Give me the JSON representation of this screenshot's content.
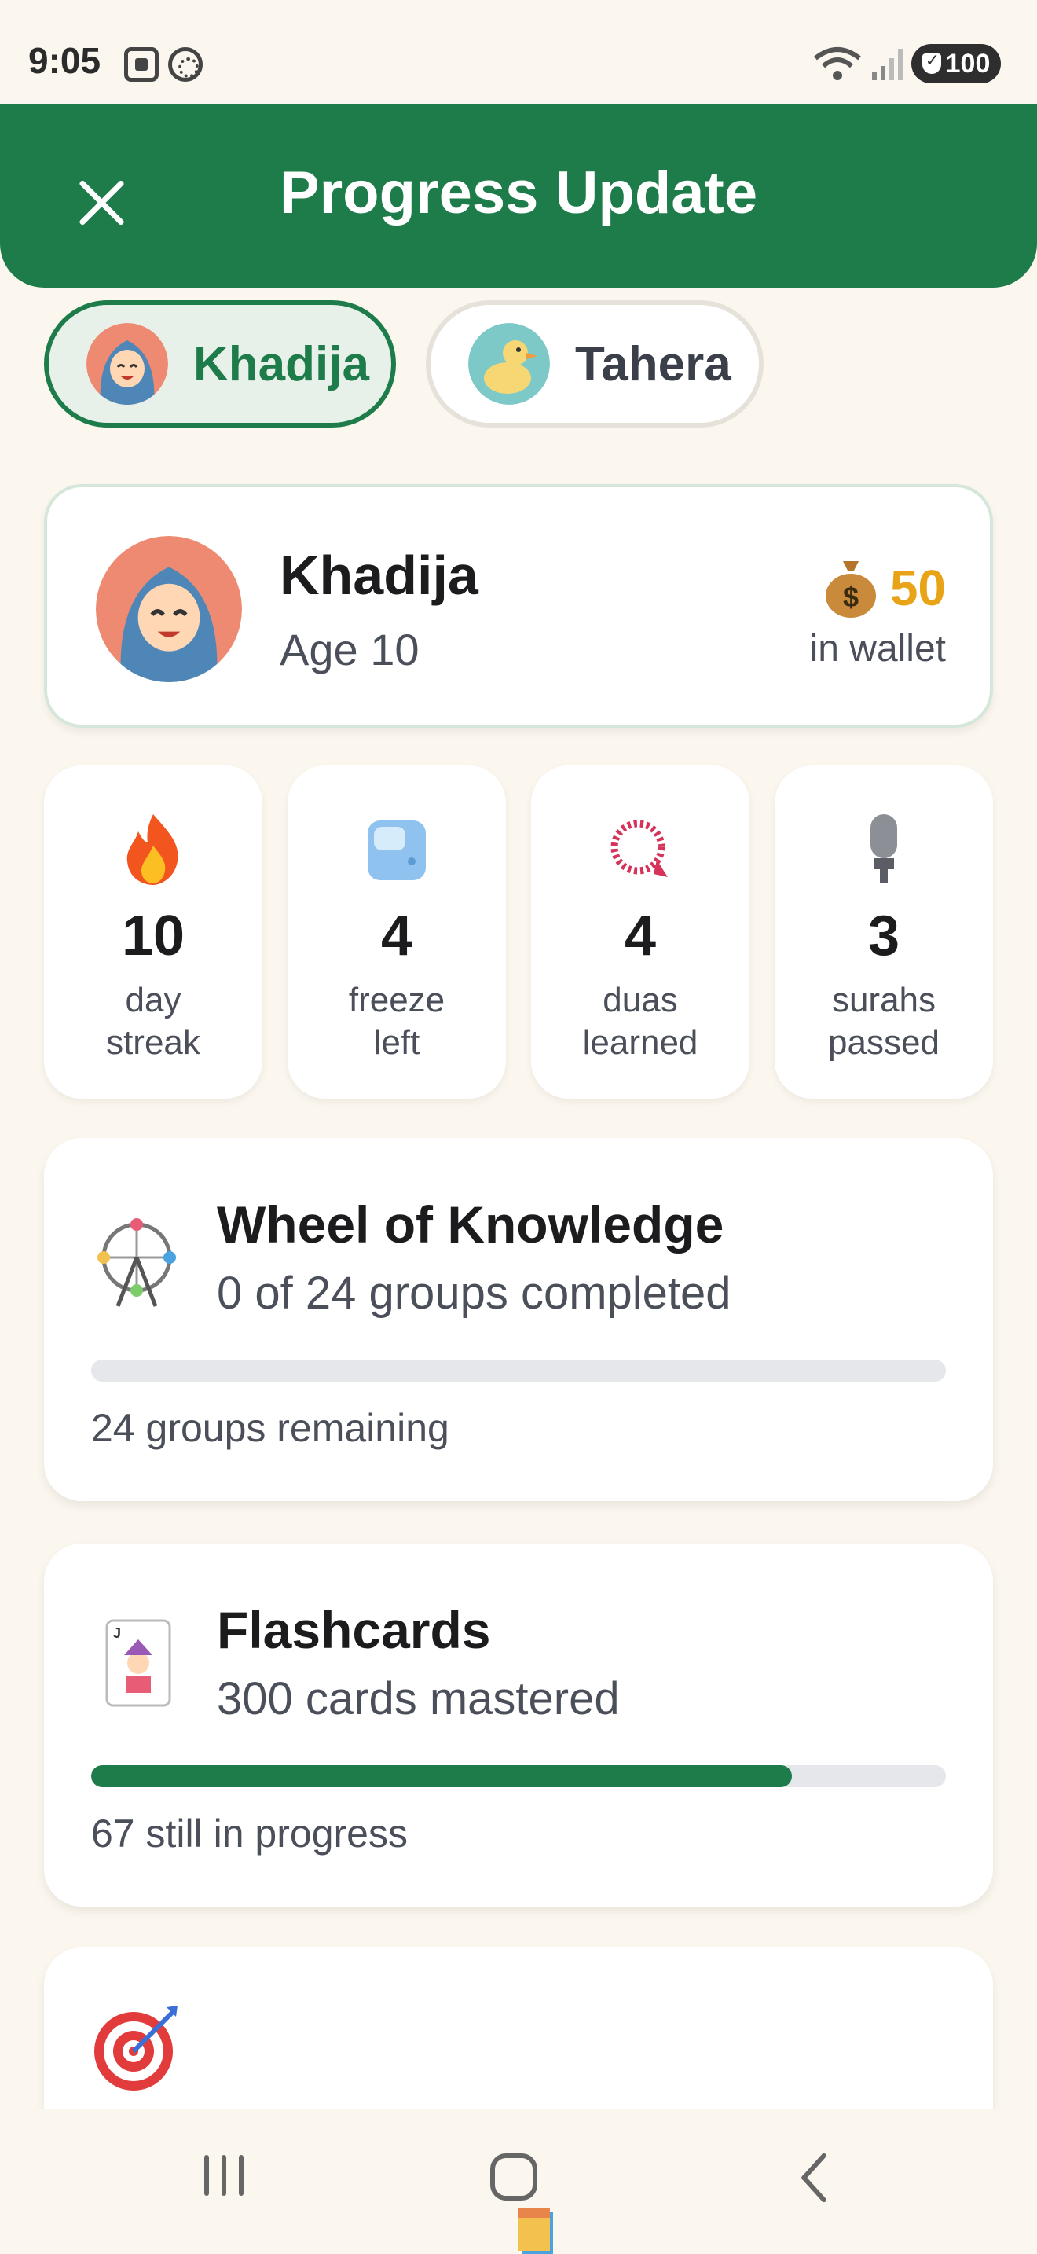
{
  "status_bar": {
    "time": "9:05",
    "battery": "100",
    "icons": [
      "screenshot-icon",
      "vpn-icon",
      "wifi-icon",
      "signal-icon",
      "battery-icon"
    ]
  },
  "header": {
    "title": "Progress Update",
    "close_icon": "close-icon",
    "color": "#1e7c4a"
  },
  "children_tabs": [
    {
      "name": "Khadija",
      "avatar": "hijab-girl-avatar",
      "active": true
    },
    {
      "name": "Tahera",
      "avatar": "duck-avatar",
      "active": false
    }
  ],
  "profile": {
    "name": "Khadija",
    "age": "Age 10",
    "wallet_amount": "50",
    "wallet_label": "in wallet",
    "wallet_icon": "money-bag-icon",
    "wallet_color": "#e8a317"
  },
  "stats": [
    {
      "icon": "fire-icon",
      "value": "10",
      "label_line1": "day",
      "label_line2": "streak"
    },
    {
      "icon": "ice-cube-icon",
      "value": "4",
      "label_line1": "freeze",
      "label_line2": "left"
    },
    {
      "icon": "prayer-beads-icon",
      "value": "4",
      "label_line1": "duas",
      "label_line2": "learned"
    },
    {
      "icon": "microphone-icon",
      "value": "3",
      "label_line1": "surahs",
      "label_line2": "passed"
    }
  ],
  "progress_cards": [
    {
      "icon": "ferris-wheel-icon",
      "title": "Wheel of Knowledge",
      "subtitle": "0 of 24 groups completed",
      "progress": 0.0,
      "note": "24 groups remaining"
    },
    {
      "icon": "joker-card-icon",
      "title": "Flashcards",
      "subtitle": "300 cards mastered",
      "progress": 0.82,
      "note": "67 still in progress"
    },
    {
      "icon": "target-icon",
      "title": "",
      "subtitle": "",
      "progress": null,
      "note": ""
    }
  ],
  "bottom_nav": {
    "items": [
      "recent-apps-icon",
      "home-icon",
      "back-icon"
    ]
  }
}
